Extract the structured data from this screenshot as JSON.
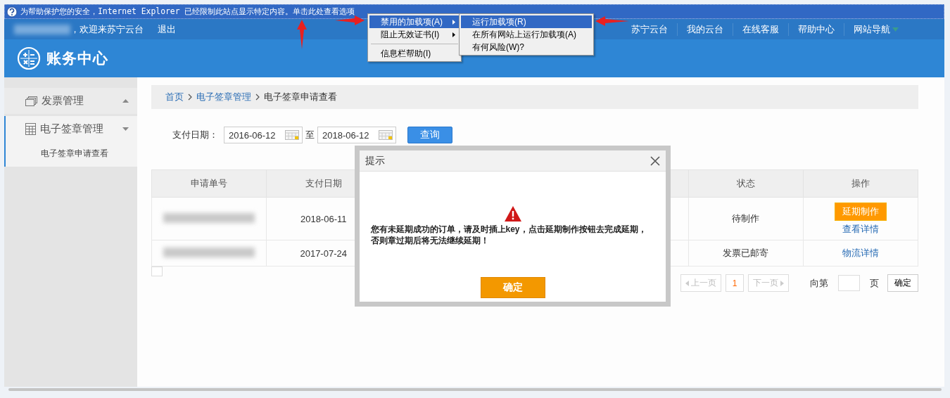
{
  "infobar": {
    "text": "为帮助保护您的安全，Internet Explorer 已经限制此站点显示特定内容。单击此处查看选项",
    "menu": [
      {
        "kind": "item",
        "label": "禁用的加载项(A)",
        "submenu": true,
        "selected": true
      },
      {
        "kind": "item",
        "label": "阻止无效证书(I)",
        "submenu": true,
        "selected": false
      },
      {
        "kind": "separator"
      },
      {
        "kind": "item",
        "label": "信息栏帮助(I)",
        "submenu": false,
        "selected": false
      }
    ],
    "submenu": [
      {
        "label": "运行加载项(R)",
        "selected": true
      },
      {
        "label": "在所有网站上运行加载项(A)",
        "selected": false
      },
      {
        "label": "有何风险(W)?",
        "selected": false
      }
    ]
  },
  "annotations": [
    {
      "kind": "right"
    },
    {
      "kind": "up"
    },
    {
      "kind": "left"
    }
  ],
  "topbar": {
    "user_redacted": true,
    "welcome": "，欢迎来苏宁云台",
    "logout": "退出",
    "links": [
      "苏宁云台",
      "我的云台",
      "在线客服",
      "帮助中心",
      "网站导航"
    ]
  },
  "header": {
    "title": "账务中心"
  },
  "sidebar": {
    "items": [
      {
        "label": "发票管理",
        "expanded": false
      },
      {
        "label": "电子签章管理",
        "expanded": true,
        "children": [
          {
            "label": "电子签章申请查看"
          }
        ]
      }
    ]
  },
  "breadcrumb": [
    {
      "label": "首页",
      "link": true
    },
    {
      "label": "电子签章管理",
      "link": true
    },
    {
      "label": "电子签章申请查看",
      "link": false
    }
  ],
  "filter": {
    "label": "支付日期：",
    "from": "2016-06-12",
    "separator": "至",
    "to": "2018-06-12",
    "button": "查询"
  },
  "table": {
    "columns": [
      "申请单号",
      "支付日期",
      "状态",
      "操作"
    ],
    "rows": [
      {
        "order_redacted": true,
        "date": "2018-06-11",
        "status": "待制作",
        "actions": [
          {
            "kind": "button",
            "label": "延期制作"
          },
          {
            "kind": "link",
            "label": "查看详情"
          }
        ]
      },
      {
        "order_redacted": true,
        "date": "2017-07-24",
        "status": "发票已邮寄",
        "actions": [
          {
            "kind": "link",
            "label": "物流详情"
          }
        ]
      }
    ]
  },
  "pagination": {
    "prev": {
      "label": "上一页",
      "disabled": true
    },
    "pages": [
      {
        "label": "1",
        "selected": true
      }
    ],
    "next": {
      "label": "下一页",
      "disabled": true
    },
    "goto_prefix": "向第",
    "goto_suffix": "页",
    "confirm": "确定"
  },
  "dialog": {
    "title": "提示",
    "message": "您有未延期成功的订单，请及时插上key，点击延期制作按钮去完成延期，否则章过期后将无法继续延期！",
    "button": "确定"
  }
}
